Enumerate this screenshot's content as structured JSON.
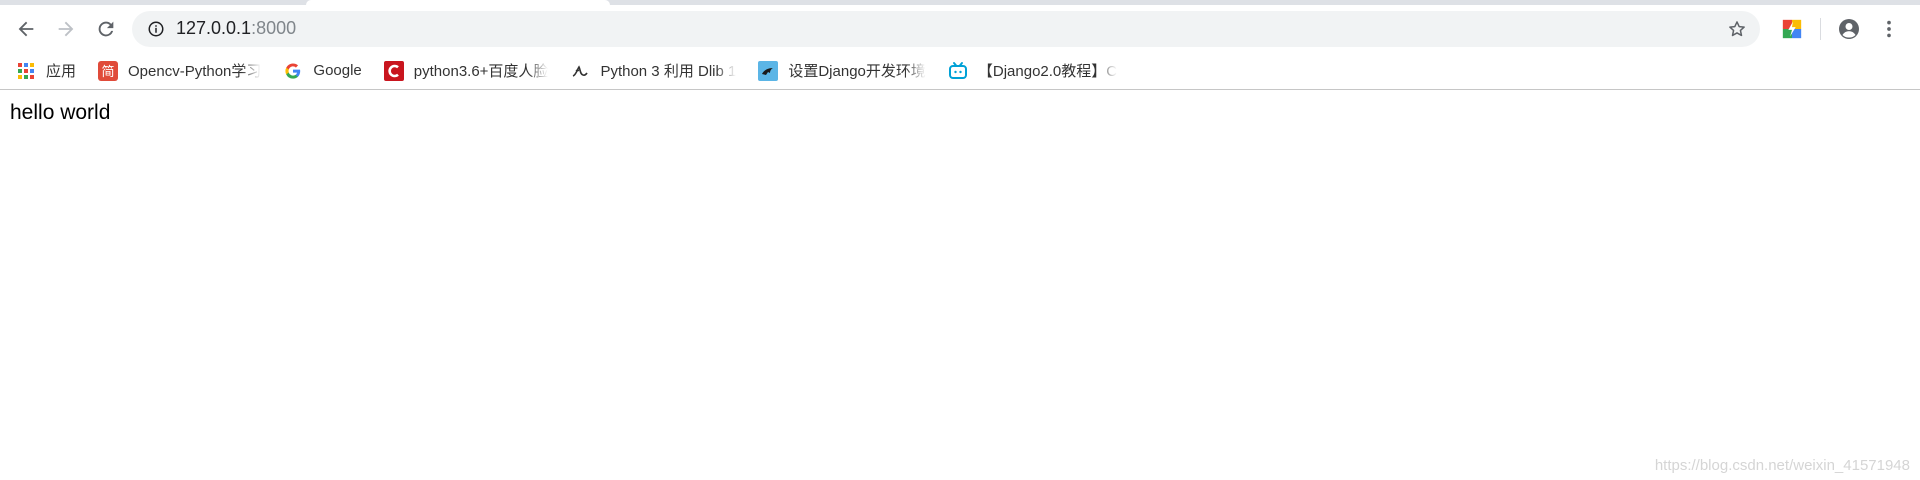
{
  "browser": {
    "address_bar": {
      "host": "127.0.0.1",
      "port": ":8000"
    },
    "bookmarks": [
      {
        "label": "应用",
        "icon": "apps-grid-icon"
      },
      {
        "label": "Opencv-Python学习",
        "icon": "jianshu-icon"
      },
      {
        "label": "Google",
        "icon": "google-icon"
      },
      {
        "label": "python3.6+百度人脸",
        "icon": "csdn-icon"
      },
      {
        "label": "Python 3 利用 Dlib 1",
        "icon": "dlib-icon"
      },
      {
        "label": "设置Django开发环境",
        "icon": "django-site-icon"
      },
      {
        "label": "【Django2.0教程】C",
        "icon": "bilibili-icon"
      }
    ]
  },
  "page": {
    "content": "hello world",
    "watermark": "https://blog.csdn.net/weixin_41571948"
  },
  "colors": {
    "accent_red": "#e04b3a",
    "csdn_red": "#c9151e",
    "bilibili_blue": "#00a1d6"
  }
}
